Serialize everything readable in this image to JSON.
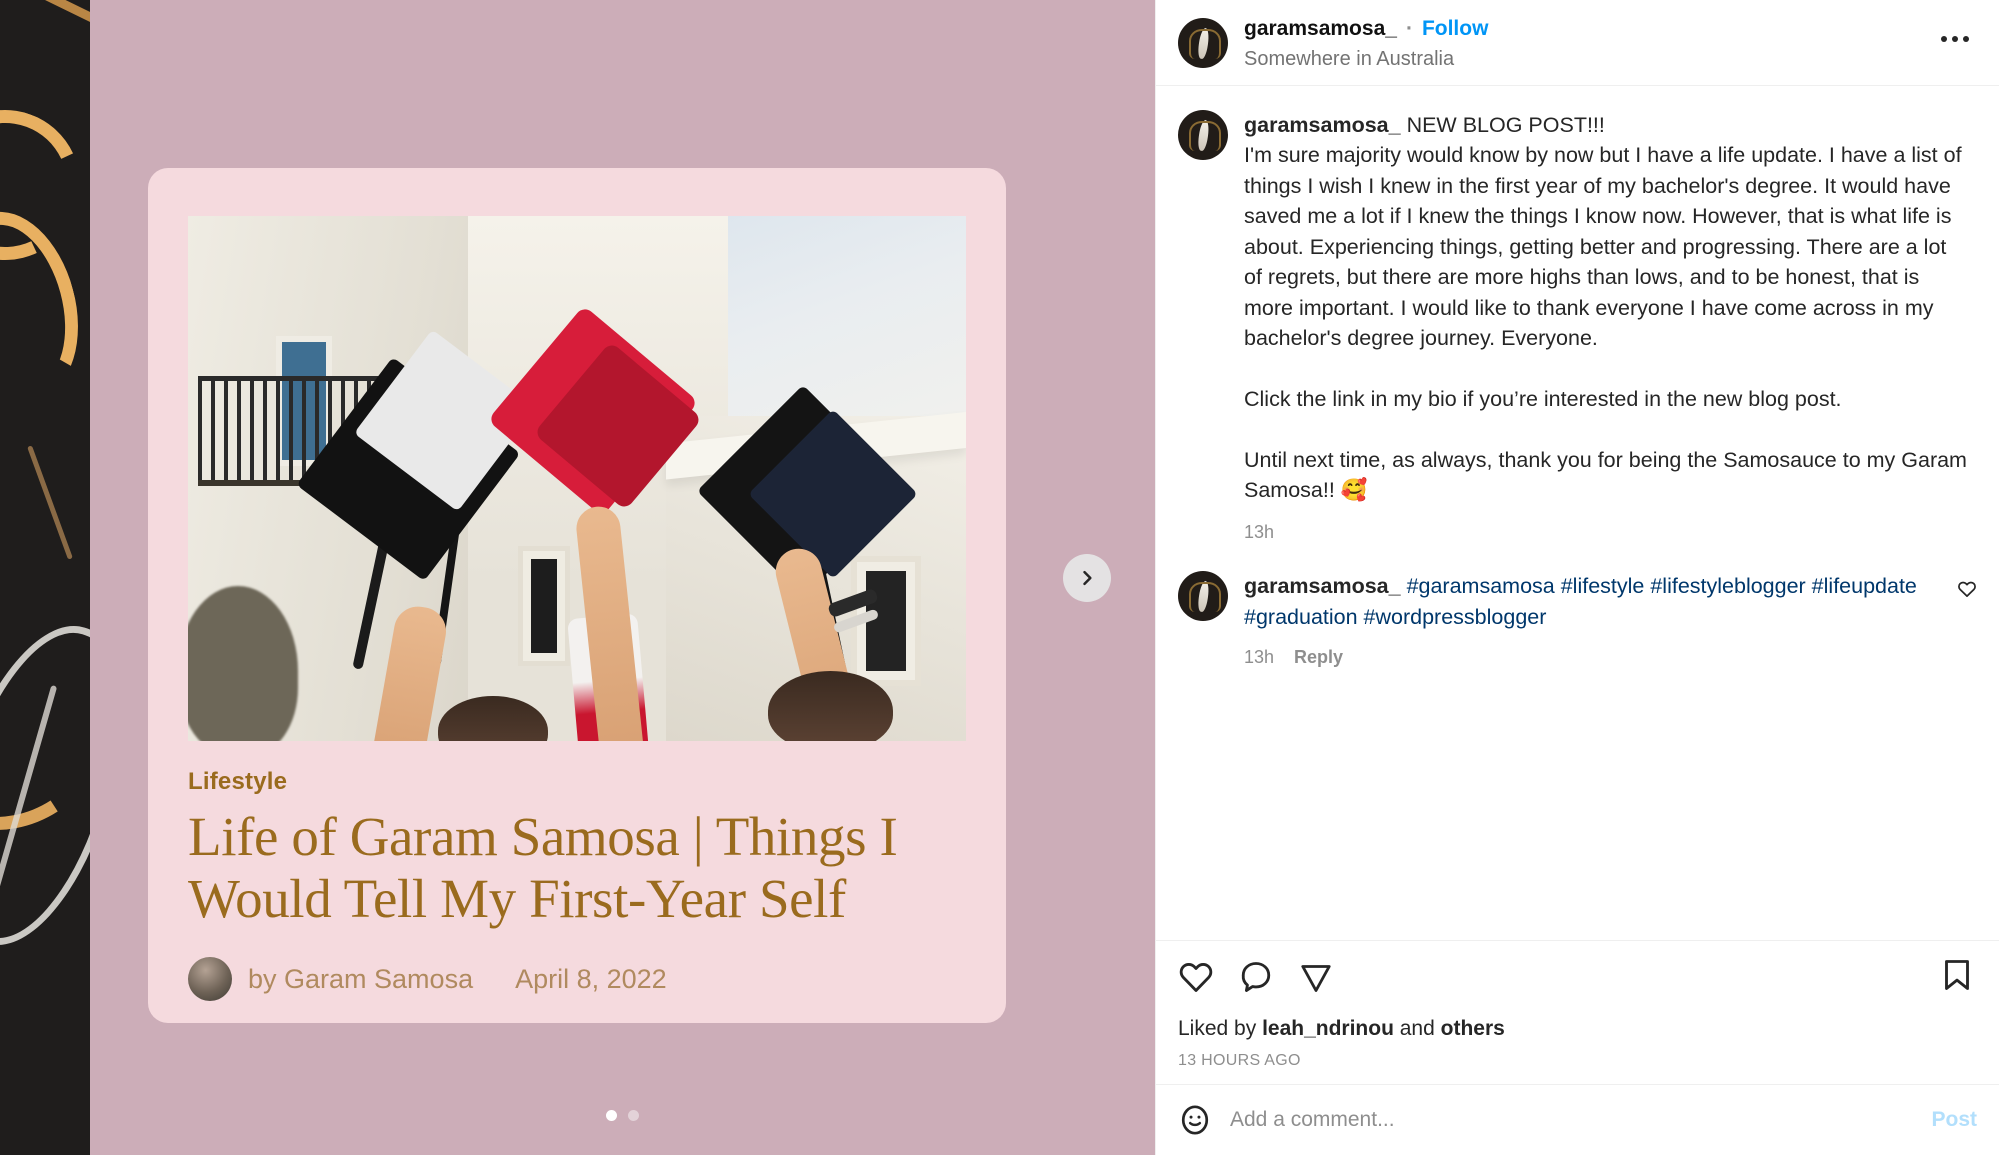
{
  "header": {
    "username": "garamsamosa_",
    "separator": "·",
    "follow_label": "Follow",
    "location": "Somewhere in Australia",
    "more_icon": "more-options-icon"
  },
  "caption": {
    "username": "garamsamosa_",
    "headline": "NEW BLOG POST!!!",
    "body": "I'm sure majority would know by now but I have a life update. I have a list of things I wish I knew in the first year of my bachelor's degree. It would have saved me a lot if I knew the things I know now. However, that is what life is about. Experiencing things, getting better and progressing. There are a lot of regrets, but there are more highs than lows, and to be honest, that is more important. I would like to thank everyone I have come across in my bachelor's degree journey. Everyone.\n\nClick the link in my bio if you’re interested in the new blog post.\n\nUntil next time, as always, thank you for being the Samosauce to my Garam Samosa!! 🥰",
    "time": "13h"
  },
  "comment": {
    "username": "garamsamosa_",
    "hashtags": "#garamsamosa #lifestyle #lifestyleblogger #lifeupdate #graduation #wordpressblogger",
    "time": "13h",
    "reply_label": "Reply",
    "like_icon": "heart-icon"
  },
  "actions": {
    "like_icon": "heart-icon",
    "comment_icon": "comment-bubble-icon",
    "share_icon": "share-paper-plane-icon",
    "save_icon": "bookmark-icon",
    "liked_by_prefix": "Liked by ",
    "liked_by_user": "leah_ndrinou",
    "liked_by_middle": " and ",
    "liked_by_suffix": "others",
    "posted_time": "13 HOURS AGO"
  },
  "add_comment": {
    "emoji_icon": "smiley-face-icon",
    "placeholder": "Add a comment...",
    "post_label": "Post"
  },
  "media": {
    "carousel_next_icon": "chevron-right-icon",
    "dots_total": 2,
    "dot_active_index": 0,
    "card": {
      "category": "Lifestyle",
      "title": "Life of Garam Samosa | Things I Would Tell My First-Year Self",
      "author": "by Garam Samosa",
      "date": "April 8, 2022",
      "photo_alt": "graduation-caps-thrown-in-air"
    }
  },
  "colors": {
    "follow_blue": "#0095f6",
    "hashtag_blue": "#00376b",
    "card_bg": "#f5dade",
    "slide_bg": "#ccadb8",
    "backdrop_dark": "#1f1d1c",
    "gold": "#e8b061",
    "title_brown": "#9a6b1e",
    "byline_brown": "#b08a5f",
    "post_btn": "#b2dffc",
    "muted_gray": "#8e8e8e"
  }
}
